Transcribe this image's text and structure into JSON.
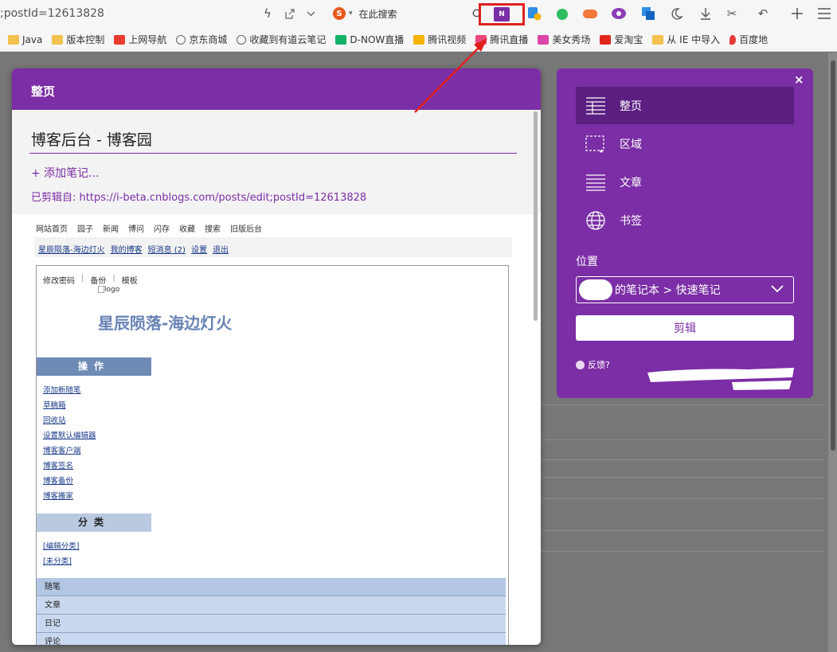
{
  "toolbar": {
    "url_text": ";postId=12613828",
    "search_engine_logo": "S",
    "search_placeholder": "在此搜索",
    "onenote_label": "N",
    "icons": [
      "lightning-icon",
      "share-icon",
      "chevron-down-icon",
      "search-icon",
      "onenote-icon",
      "download-manager-icon",
      "evernote-icon",
      "game-icon",
      "chat-icon",
      "translate-icon",
      "night-mode-icon",
      "download-icon",
      "scissors-icon",
      "undo-icon",
      "plus-icon",
      "menu-icon"
    ]
  },
  "bookmarks": [
    {
      "label": "Java",
      "icon": "folder-icon"
    },
    {
      "label": "版本控制",
      "icon": "folder-icon"
    },
    {
      "label": "上网导航",
      "icon": "hao-icon"
    },
    {
      "label": "京东商城",
      "icon": "globe-icon"
    },
    {
      "label": "收藏到有道云笔记",
      "icon": "globe-icon"
    },
    {
      "label": "D-NOW直播",
      "icon": "dnow-icon"
    },
    {
      "label": "腾讯视频",
      "icon": "video-icon"
    },
    {
      "label": "腾讯直播",
      "icon": "live-icon"
    },
    {
      "label": "美女秀场",
      "icon": "show-icon"
    },
    {
      "label": "爱淘宝",
      "icon": "taobao-icon"
    },
    {
      "label": "从 IE 中导入",
      "icon": "folder-icon"
    },
    {
      "label": "百度地",
      "icon": "map-pin-icon"
    }
  ],
  "clip_dialog": {
    "header": "整页",
    "title": "博客后台 - 博客园",
    "add_note": "+ 添加笔记...",
    "source": "已剪辑自: https://i-beta.cnblogs.com/posts/edit;postId=12613828"
  },
  "preview": {
    "nav_top": [
      "网站首页",
      "园子",
      "新闻",
      "博问",
      "闪存",
      "收藏",
      "搜索",
      "旧版后台"
    ],
    "nav_second": [
      "星辰陨落-海边灯火",
      "我的博客",
      "短消息 (2)",
      "设置",
      "退出"
    ],
    "tools": [
      "修改密码",
      "|",
      "备份",
      "|",
      "模板"
    ],
    "logo_alt": "logo",
    "blog_name": "星辰陨落-海边灯火",
    "ops_heading": "操作",
    "ops_links": [
      "添加新随笔",
      "草稿箱",
      "回收站",
      "设置默认编辑器",
      "博客客户端",
      "博客签名",
      "博客备份",
      "博客搬家"
    ],
    "category_heading": "分类",
    "category_links": [
      "[编辑分类]",
      "[未分类]"
    ],
    "category_table": [
      "随笔",
      "文章",
      "日记",
      "评论"
    ]
  },
  "panel": {
    "close": "×",
    "modes": [
      {
        "label": "整页",
        "icon": "full-page-icon",
        "selected": true
      },
      {
        "label": "区域",
        "icon": "region-select-icon",
        "selected": false
      },
      {
        "label": "文章",
        "icon": "article-icon",
        "selected": false
      },
      {
        "label": "书签",
        "icon": "globe-icon",
        "selected": false
      }
    ],
    "location_label": "位置",
    "location_value": "的笔记本 > 快速笔记",
    "clip_button": "剪辑",
    "feedback": "反馈?"
  },
  "colors": {
    "onenote_purple": "#7b2ea5",
    "selected_mode": "#5b1f82",
    "annotation_red": "#e02020"
  }
}
